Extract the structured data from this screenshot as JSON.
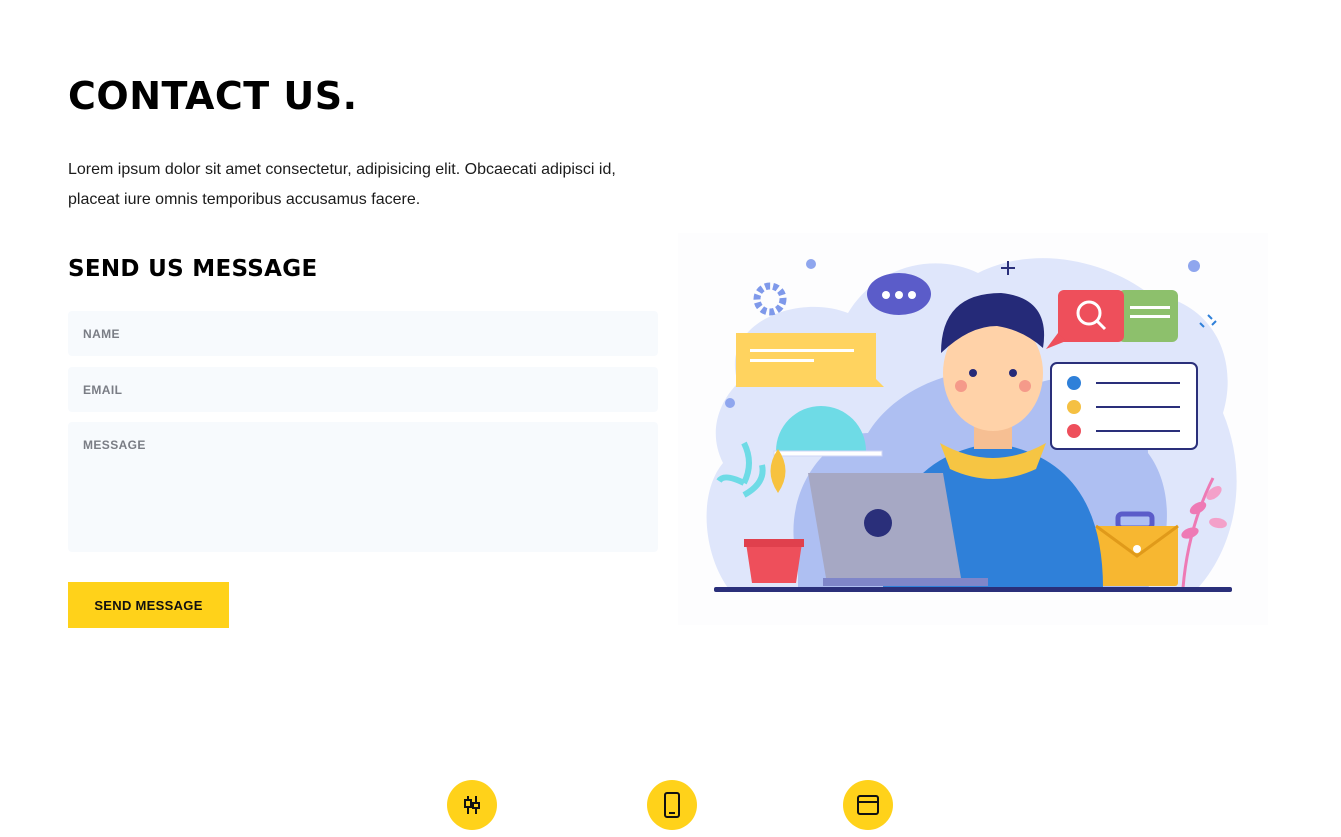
{
  "header": {
    "title": "CONTACT US.",
    "intro": "Lorem ipsum dolor sit amet consectetur, adipisicing elit. Obcaecati adipisci id, placeat iure omnis temporibus accusamus facere."
  },
  "form": {
    "heading": "SEND US MESSAGE",
    "name_placeholder": "NAME",
    "email_placeholder": "EMAIL",
    "message_placeholder": "MESSAGE",
    "submit_label": "SEND MESSAGE"
  },
  "illustration": {
    "subject": "person-working-on-laptop",
    "icons": [
      "gear-icon",
      "chat-bubble-icon",
      "search-icon",
      "checklist-icon",
      "briefcase-icon",
      "plant-icon"
    ]
  },
  "features": {
    "icons": [
      "sliders-icon",
      "smartphone-icon",
      "browser-window-icon"
    ]
  },
  "colors": {
    "accent": "#ffd21a",
    "field_bg": "#f7fafd",
    "heading": "#000000",
    "illustration_blue": "#2f80d9",
    "illustration_navy": "#2a2f7a"
  }
}
